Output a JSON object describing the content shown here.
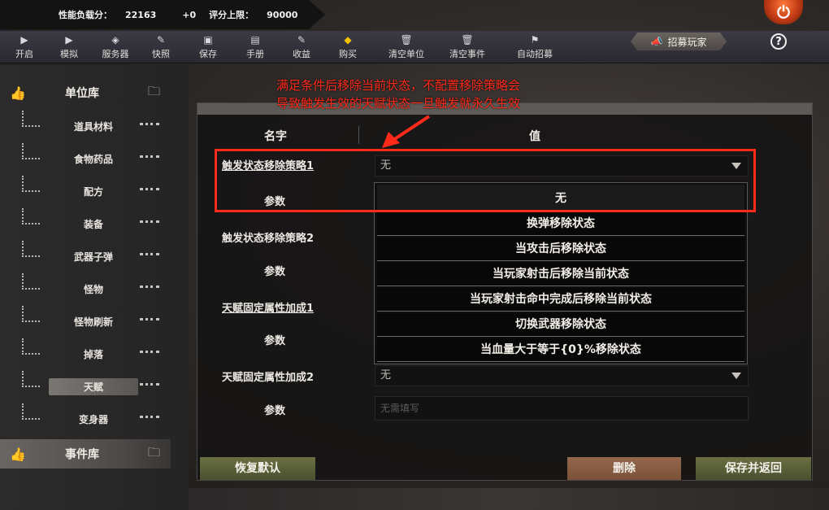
{
  "stats": {
    "load_label": "性能负载分：",
    "load_value": "22163",
    "load_delta": "+0",
    "limit_label": "评分上限：",
    "limit_value": "90000"
  },
  "power_icon": "power-icon",
  "toolbar": {
    "items": [
      {
        "label": "开启",
        "icon": "play-icon"
      },
      {
        "label": "模拟",
        "icon": "play-icon"
      },
      {
        "label": "服务器",
        "icon": "cube-icon"
      },
      {
        "label": "快照",
        "icon": "edit-icon"
      },
      {
        "label": "保存",
        "icon": "save-icon"
      },
      {
        "label": "手册",
        "icon": "manual-icon"
      },
      {
        "label": "收益",
        "icon": "edit-icon"
      },
      {
        "label": "购买",
        "icon": "cube-yellow-icon"
      },
      {
        "label": "清空单位",
        "icon": "trash-icon"
      },
      {
        "label": "清空事件",
        "icon": "trash-icon"
      },
      {
        "label": "自动招募",
        "icon": "flag-icon"
      }
    ],
    "recruit_label": "招募玩家",
    "help_label": "?"
  },
  "sidebar": {
    "unit_library": "单位库",
    "event_library": "事件库",
    "items": [
      {
        "label": "道具材料"
      },
      {
        "label": "食物药品"
      },
      {
        "label": "配方"
      },
      {
        "label": "装备"
      },
      {
        "label": "武器子弹"
      },
      {
        "label": "怪物"
      },
      {
        "label": "怪物刷新"
      },
      {
        "label": "掉落"
      },
      {
        "label": "天赋"
      },
      {
        "label": "变身器"
      }
    ],
    "selected": "天赋"
  },
  "panel": {
    "col_name": "名字",
    "col_value": "值",
    "rows": [
      {
        "label": "触发状态移除策略1",
        "value": "无"
      },
      {
        "label": "参数"
      },
      {
        "label": "触发状态移除策略2"
      },
      {
        "label": "参数"
      },
      {
        "label": "天赋固定属性加成1"
      },
      {
        "label": "参数"
      },
      {
        "label": "天赋固定属性加成2",
        "value": "无"
      },
      {
        "label": "参数",
        "placeholder": "无需填写"
      }
    ],
    "dropdown_options": [
      "无",
      "换弹移除状态",
      "当攻击后移除状态",
      "当玩家射击后移除当前状态",
      "当玩家射击命中完成后移除当前状态",
      "切换武器移除状态",
      "当血量大于等于{0}%移除状态"
    ]
  },
  "buttons": {
    "reset": "恢复默认",
    "delete": "删除",
    "save_return": "保存并返回"
  },
  "annotation": {
    "line1": "满足条件后移除当前状态，不配置移除策略会",
    "line2": "导致触发生效的天赋状态一旦触发就永久生效",
    "color": "#ff2a1a"
  }
}
